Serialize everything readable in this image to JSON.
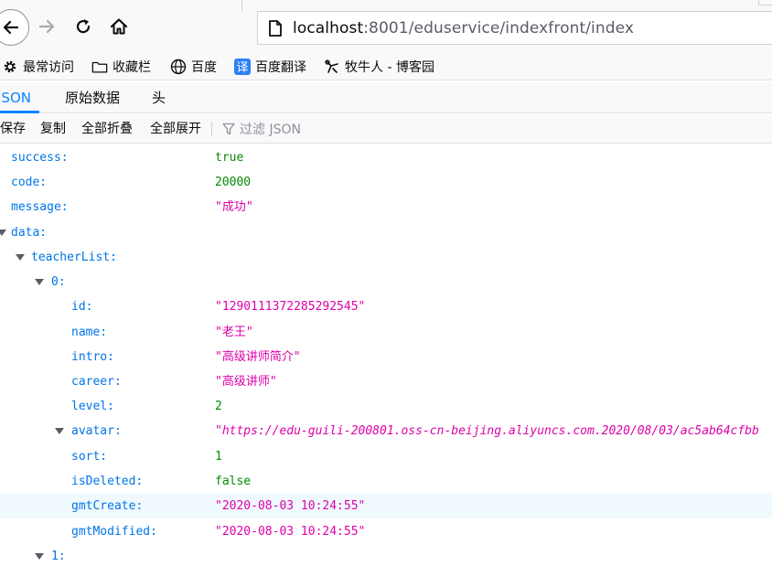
{
  "navbar": {
    "url_host": "localhost",
    "url_rest": ":8001/eduservice/indexfront/index"
  },
  "bookmarks": [
    {
      "label": "最常访问",
      "icon": "gear-icon"
    },
    {
      "label": "收藏栏",
      "icon": "folder-icon"
    },
    {
      "label": "百度",
      "icon": "globe-icon"
    },
    {
      "label": "百度翻译",
      "icon": "translate-icon"
    },
    {
      "label": "牧牛人 - 博客园",
      "icon": "blog-icon"
    }
  ],
  "tabs": {
    "json": "JSON",
    "raw": "原始数据",
    "headers": "头"
  },
  "toolbar": {
    "save": "保存",
    "copy": "复制",
    "collapse_all": "全部折叠",
    "expand_all": "全部展开",
    "filter_placeholder": "过滤 JSON"
  },
  "tree": {
    "success_key": "success:",
    "success_val": "true",
    "code_key": "code:",
    "code_val": "20000",
    "message_key": "message:",
    "message_val": "\"成功\"",
    "data_key": "data:",
    "teacherList_key": "teacherList:",
    "item0_key": "0:",
    "id_key": "id:",
    "id_val": "\"1290111372285292545\"",
    "name_key": "name:",
    "name_val": "\"老王\"",
    "intro_key": "intro:",
    "intro_val": "\"高级讲师简介\"",
    "career_key": "career:",
    "career_val": "\"高级讲师\"",
    "level_key": "level:",
    "level_val": "2",
    "avatar_key": "avatar:",
    "avatar_val": "\"https://edu-guili-200801.oss-cn-beijing.aliyuncs.com.2020/08/03/ac5ab64cfbb",
    "sort_key": "sort:",
    "sort_val": "1",
    "isDeleted_key": "isDeleted:",
    "isDeleted_val": "false",
    "gmtCreate_key": "gmtCreate:",
    "gmtCreate_val": "\"2020-08-03 10:24:55\"",
    "gmtModified_key": "gmtModified:",
    "gmtModified_val": "\"2020-08-03 10:24:55\"",
    "item1_key": "1:"
  }
}
